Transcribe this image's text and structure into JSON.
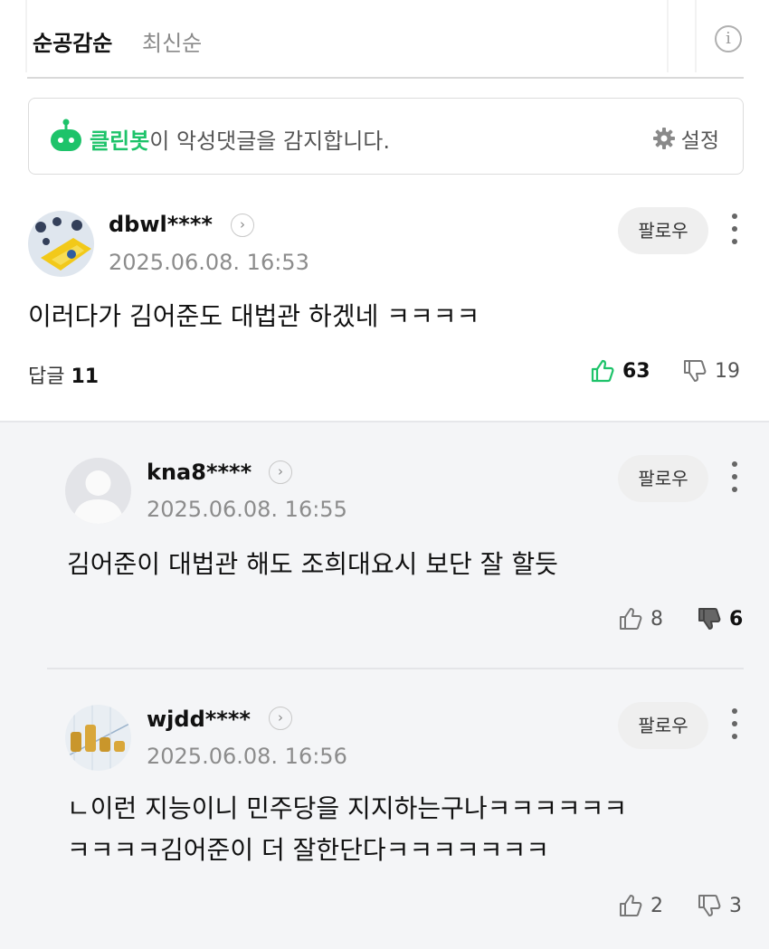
{
  "sort": {
    "active_tab": "순공감순",
    "inactive_tab": "최신순",
    "info_icon": "info-icon"
  },
  "cleanbot": {
    "name": "클린봇",
    "message": "이 악성댓글을 감지합니다.",
    "settings_label": "설정",
    "accent_color": "#1ec36a"
  },
  "comments": [
    {
      "username": "dbwl****",
      "date": "2025.06.08. 16:53",
      "follow_label": "팔로우",
      "text": "이러다가 김어준도 대법관 하겠네 ㅋㅋㅋㅋ",
      "reply_label": "답글",
      "reply_count": "11",
      "likes": "63",
      "dislikes": "19"
    },
    {
      "username": "kna8****",
      "date": "2025.06.08. 16:55",
      "follow_label": "팔로우",
      "text": "김어준이 대법관 해도 조희대요시 보단 잘 할듯",
      "likes": "8",
      "dislikes": "6"
    },
    {
      "username": "wjdd****",
      "date": "2025.06.08. 16:56",
      "follow_label": "팔로우",
      "text_line1": "ㄴ이런 지능이니 민주당을 지지하는구나ㅋㅋㅋㅋㅋㅋ",
      "text_line2": "ㅋㅋㅋㅋ김어준이 더 잘한단다ㅋㅋㅋㅋㅋㅋㅋ",
      "likes": "2",
      "dislikes": "3"
    }
  ]
}
